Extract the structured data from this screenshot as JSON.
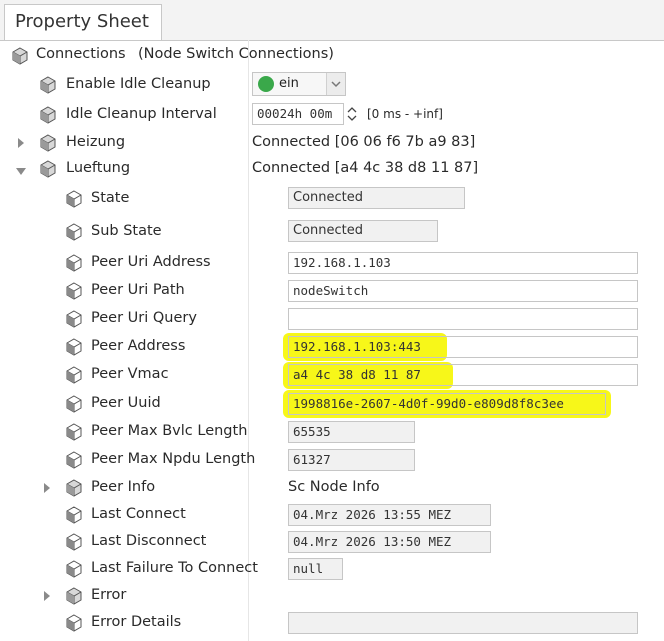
{
  "tab": {
    "title": "Property Sheet"
  },
  "root": {
    "label": "Connections",
    "value": "(Node Switch Connections)"
  },
  "idle": {
    "label": "Enable Idle Cleanup",
    "value": "ein",
    "status_color": "#3aa84a"
  },
  "interval": {
    "label": "Idle Cleanup Interval",
    "value": "00024h 00m",
    "range": "[0 ms - +inf]"
  },
  "heizung": {
    "label": "Heizung",
    "value": "Connected [06 06 f6 7b a9 83]"
  },
  "lueftung": {
    "label": "Lueftung",
    "value": "Connected [a4 4c 38 d8 11 87]"
  },
  "props": [
    {
      "label": "State",
      "value": "Connected"
    },
    {
      "label": "Sub State",
      "value": "Connected"
    },
    {
      "label": "Peer Uri Address",
      "value": "192.168.1.103"
    },
    {
      "label": "Peer Uri Path",
      "value": "nodeSwitch"
    },
    {
      "label": "Peer Uri Query",
      "value": ""
    },
    {
      "label": "Peer Address",
      "value": "192.168.1.103:443"
    },
    {
      "label": "Peer Vmac",
      "value": "a4 4c 38 d8 11 87"
    },
    {
      "label": "Peer Uuid",
      "value": "1998816e-2607-4d0f-99d0-e809d8f8c3ee"
    },
    {
      "label": "Peer Max Bvlc Length",
      "value": "65535"
    },
    {
      "label": "Peer Max Npdu Length",
      "value": "61327"
    },
    {
      "label": "Peer Info",
      "value": "Sc Node Info"
    },
    {
      "label": "Last Connect",
      "value": "04.Mrz 2026 13:55 MEZ"
    },
    {
      "label": "Last Disconnect",
      "value": "04.Mrz 2026 13:50 MEZ"
    },
    {
      "label": "Last Failure To Connect",
      "value": "null"
    },
    {
      "label": "Error",
      "value": ""
    },
    {
      "label": "Error Details",
      "value": ""
    }
  ],
  "colors": {
    "highlight": "#f6f600"
  }
}
